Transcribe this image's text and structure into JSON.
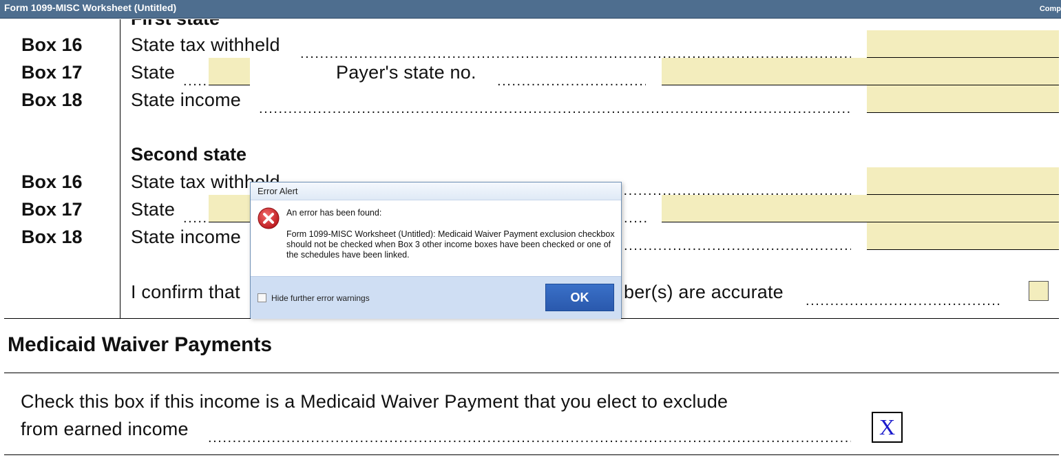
{
  "window": {
    "title": "Form 1099-MISC Worksheet (Untitled)",
    "right_text": "Comp"
  },
  "first_state": {
    "heading": "First state",
    "box16": {
      "box": "Box 16",
      "label": "State tax withheld",
      "value": ""
    },
    "box17": {
      "box": "Box 17",
      "label": "State",
      "payer_label": "Payer's state no.",
      "state_value": "",
      "payer_value": ""
    },
    "box18": {
      "box": "Box 18",
      "label": "State income",
      "value": ""
    }
  },
  "second_state": {
    "heading": "Second state",
    "box16": {
      "box": "Box 16",
      "label": "State tax withheld",
      "value": ""
    },
    "box17": {
      "box": "Box 17",
      "label": "State",
      "state_value": "",
      "payer_value": ""
    },
    "box18": {
      "box": "Box 18",
      "label": "State income",
      "value": ""
    }
  },
  "confirm": {
    "label_start": "I confirm that",
    "label_end": "ber(s) are accurate",
    "checked": false
  },
  "medicaid": {
    "heading": "Medicaid Waiver Payments",
    "line1": "Check this box if this income is a Medicaid Waiver Payment that you elect to exclude",
    "line2": "from earned income",
    "checkbox_value": "X"
  },
  "dialog": {
    "title": "Error Alert",
    "header": "An error has been found:",
    "message": "Form 1099-MISC Worksheet (Untitled): Medicaid Waiver Payment exclusion checkbox should not be checked when Box 3 other income boxes have been checked or one of the schedules have been linked.",
    "hide_label": "Hide further error warnings",
    "ok_label": "OK",
    "icon": "error-icon",
    "colors": {
      "ok_button": "#2a59ad",
      "footer": "#cfdef3",
      "error_red": "#d2262a"
    }
  },
  "colors": {
    "titlebar": "#4e6e8f",
    "field_fill": "#f3edbd",
    "check_x": "#1a1acc"
  }
}
